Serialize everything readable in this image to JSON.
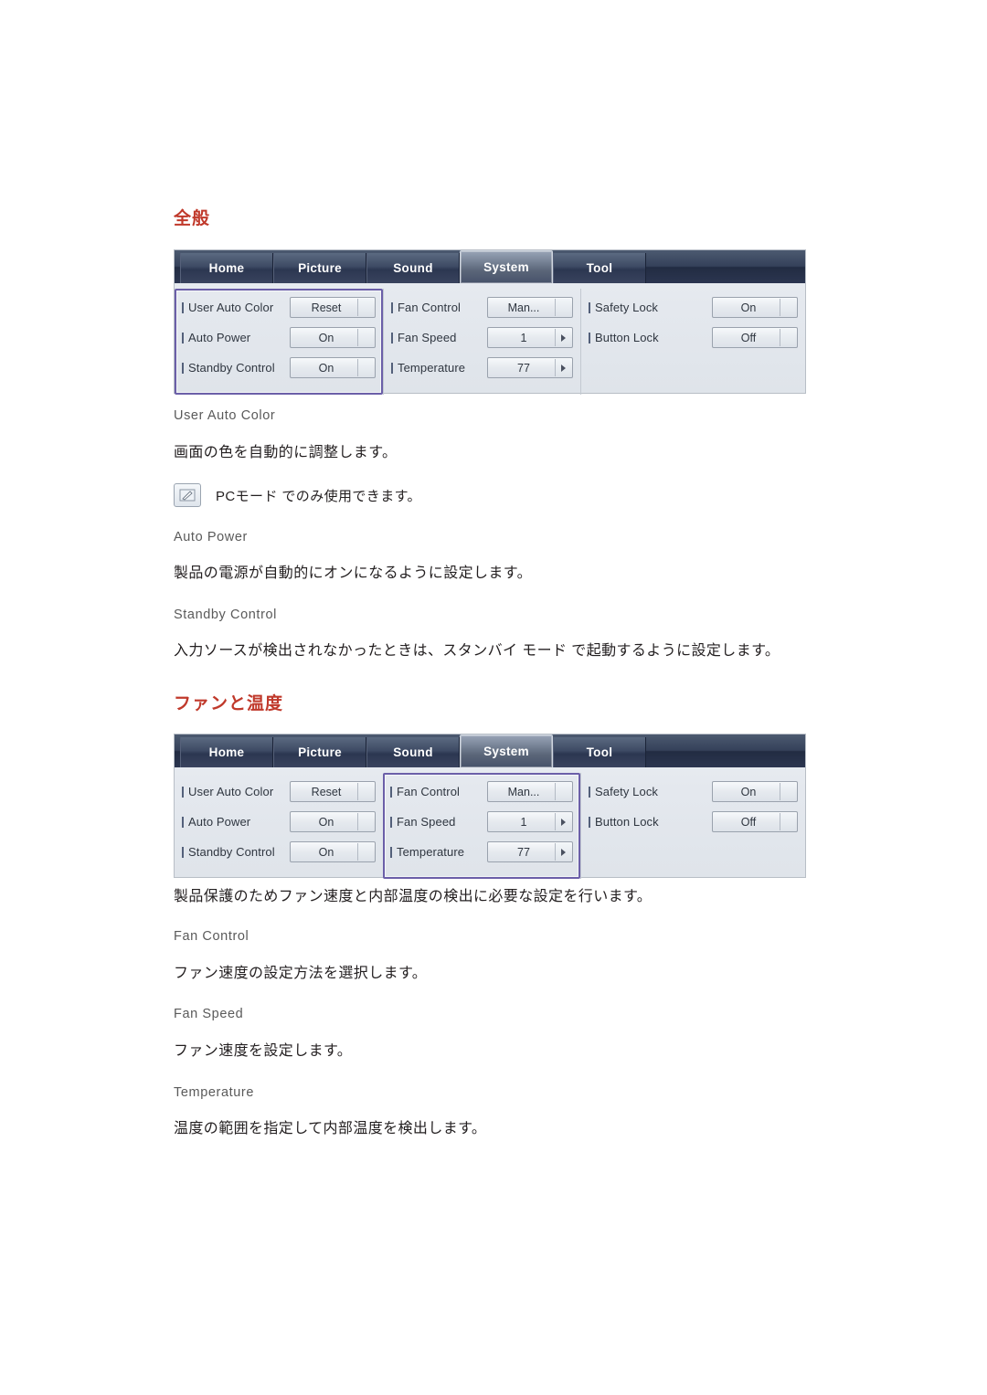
{
  "sections": [
    {
      "heading": "全般",
      "osd": {
        "tabs": [
          {
            "label": "Home",
            "active": false
          },
          {
            "label": "Picture",
            "active": false
          },
          {
            "label": "Sound",
            "active": false
          },
          {
            "label": "System",
            "active": true
          },
          {
            "label": "Tool",
            "active": false
          }
        ],
        "columns": [
          {
            "highlighted": true,
            "rows": [
              {
                "label": "User Auto Color",
                "value": "Reset",
                "caret": "down"
              },
              {
                "label": "Auto Power",
                "value": "On",
                "caret": "down"
              },
              {
                "label": "Standby Control",
                "value": "On",
                "caret": "down"
              }
            ]
          },
          {
            "highlighted": false,
            "rows": [
              {
                "label": "Fan Control",
                "value": "Man...",
                "caret": "down"
              },
              {
                "label": "Fan Speed",
                "value": "1",
                "caret": "right"
              },
              {
                "label": "Temperature",
                "value": "77",
                "caret": "right"
              }
            ]
          },
          {
            "highlighted": false,
            "rows": [
              {
                "label": "Safety Lock",
                "value": "On",
                "caret": "down"
              },
              {
                "label": "Button Lock",
                "value": "Off",
                "caret": "down"
              }
            ]
          }
        ]
      },
      "items": [
        {
          "title": "User Auto Color",
          "body": "画面の色を自動的に調整します。"
        },
        {
          "title": "Auto Power",
          "body": "製品の電源が自動的にオンになるように設定します。"
        },
        {
          "title": "Standby Control",
          "body": "入力ソースが検出されなかったときは、スタンバイ モード で起動するように設定します。"
        }
      ],
      "note": {
        "icon": "note-pencil-icon",
        "text": "PCモード でのみ使用できます。"
      }
    },
    {
      "heading": "ファンと温度",
      "osd": {
        "tabs": [
          {
            "label": "Home",
            "active": false
          },
          {
            "label": "Picture",
            "active": false
          },
          {
            "label": "Sound",
            "active": false
          },
          {
            "label": "System",
            "active": true
          },
          {
            "label": "Tool",
            "active": false
          }
        ],
        "columns": [
          {
            "highlighted": false,
            "rows": [
              {
                "label": "User Auto Color",
                "value": "Reset",
                "caret": "down"
              },
              {
                "label": "Auto Power",
                "value": "On",
                "caret": "down"
              },
              {
                "label": "Standby Control",
                "value": "On",
                "caret": "down"
              }
            ]
          },
          {
            "highlighted": true,
            "rows": [
              {
                "label": "Fan Control",
                "value": "Man...",
                "caret": "down"
              },
              {
                "label": "Fan Speed",
                "value": "1",
                "caret": "right"
              },
              {
                "label": "Temperature",
                "value": "77",
                "caret": "right"
              }
            ]
          },
          {
            "highlighted": false,
            "rows": [
              {
                "label": "Safety Lock",
                "value": "On",
                "caret": "down"
              },
              {
                "label": "Button Lock",
                "value": "Off",
                "caret": "down"
              }
            ]
          }
        ]
      },
      "intro": "製品保護のためファン速度と内部温度の検出に必要な設定を行います。",
      "items": [
        {
          "title": "Fan Control",
          "body": "ファン速度の設定方法を選択します。"
        },
        {
          "title": "Fan Speed",
          "body": "ファン速度を設定します。"
        },
        {
          "title": "Temperature",
          "body": "温度の範囲を指定して内部温度を検出します。"
        }
      ]
    }
  ],
  "colors": {
    "heading_red": "#c0392b",
    "highlight_purple": "#6b5fa8",
    "subhead_gray": "#5a5a5a"
  }
}
